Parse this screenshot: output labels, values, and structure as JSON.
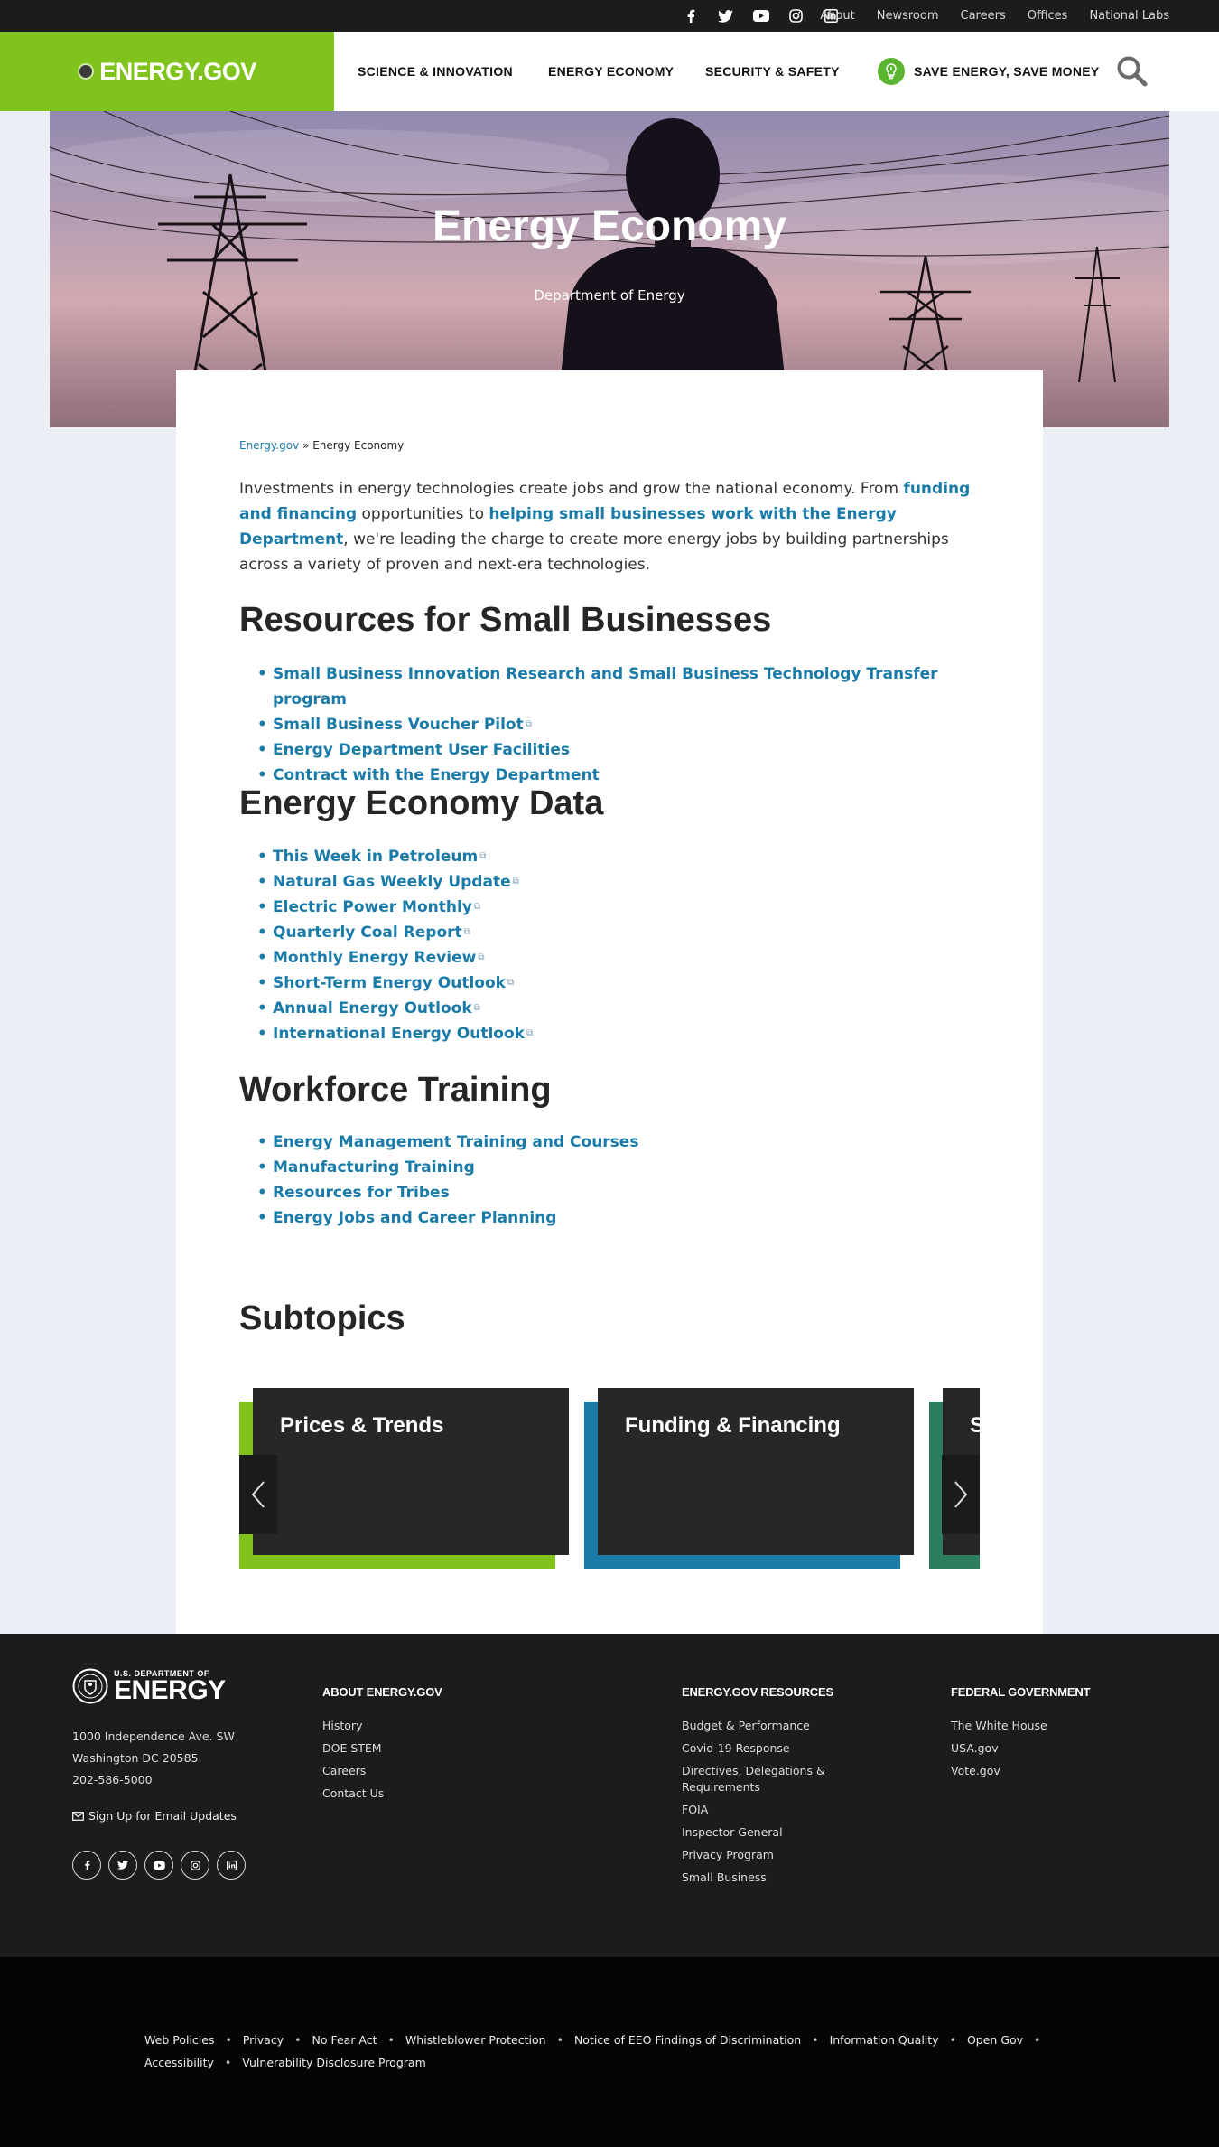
{
  "utility": {
    "social_icons": [
      "facebook-icon",
      "twitter-icon",
      "youtube-icon",
      "instagram-icon",
      "linkedin-icon"
    ],
    "links": [
      "About",
      "Newsroom",
      "Careers",
      "Offices",
      "National Labs"
    ]
  },
  "header": {
    "logo": "ENERGY.GOV",
    "nav": [
      "SCIENCE & INNOVATION",
      "ENERGY ECONOMY",
      "SECURITY & SAFETY"
    ],
    "save_energy": "SAVE ENERGY, SAVE MONEY",
    "brand_color": "#7fc31c"
  },
  "hero": {
    "title": "Energy Economy",
    "subtitle": "Department of Energy"
  },
  "breadcrumb": {
    "home": "Energy.gov",
    "separator": "»",
    "current": "Energy Economy"
  },
  "intro": {
    "part1": "Investments in energy technologies create jobs and grow the national economy. From ",
    "link1": "funding and financing",
    "part2": " opportunities to ",
    "link2": "helping small businesses work with the Energy Department",
    "part3": ", we're leading the charge to create more energy jobs by building partnerships across a variety of proven and next-era technologies."
  },
  "sections": {
    "small_business": {
      "title": "Resources for Small Businesses",
      "items": [
        "Small Business Innovation Research and Small Business Technology Transfer program",
        "Small Business Voucher Pilot",
        "Energy Department User Facilities",
        "Contract with the Energy Department"
      ]
    },
    "data": {
      "title": "Energy Economy Data",
      "items": [
        "This Week in Petroleum",
        "Natural Gas Weekly Update",
        "Electric Power Monthly",
        "Quarterly Coal Report",
        "Monthly Energy Review",
        "Short-Term Energy Outlook",
        "Annual Energy Outlook",
        "International Energy Outlook"
      ]
    },
    "workforce": {
      "title": "Workforce Training",
      "items": [
        "Energy Management Training and Courses",
        "Manufacturing Training",
        "Resources for Tribes",
        "Energy Jobs and Career Planning"
      ]
    }
  },
  "subtopics": {
    "title": "Subtopics",
    "cards": [
      {
        "label": "Prices & Trends",
        "color": "#7fc31c"
      },
      {
        "label": "Funding & Financing",
        "color": "#1a7ba8"
      },
      {
        "label": "S",
        "color": "#2b7d5e"
      }
    ]
  },
  "footer": {
    "logo_small": "U.S. DEPARTMENT OF",
    "logo_big": "ENERGY",
    "address": [
      "1000 Independence Ave. SW",
      "Washington DC 20585",
      "202-586-5000"
    ],
    "email_signup": "Sign Up for Email Updates",
    "about": {
      "title": "ABOUT ENERGY.GOV",
      "items": [
        "History",
        "DOE STEM",
        "Careers",
        "Contact Us"
      ]
    },
    "resources": {
      "title": "ENERGY.GOV RESOURCES",
      "items": [
        "Budget & Performance",
        "Covid-19 Response",
        "Directives, Delegations & Requirements",
        "FOIA",
        "Inspector General",
        "Privacy Program",
        "Small Business"
      ]
    },
    "federal": {
      "title": "FEDERAL GOVERNMENT",
      "items": [
        "The White House",
        "USA.gov",
        "Vote.gov"
      ]
    }
  },
  "subfooter": {
    "row1": [
      "Web Policies",
      "Privacy",
      "No Fear Act",
      "Whistleblower Protection",
      "Notice of EEO Findings of Discrimination",
      "Information Quality",
      "Open Gov"
    ],
    "row2": [
      "Accessibility",
      "Vulnerability Disclosure Program"
    ]
  }
}
